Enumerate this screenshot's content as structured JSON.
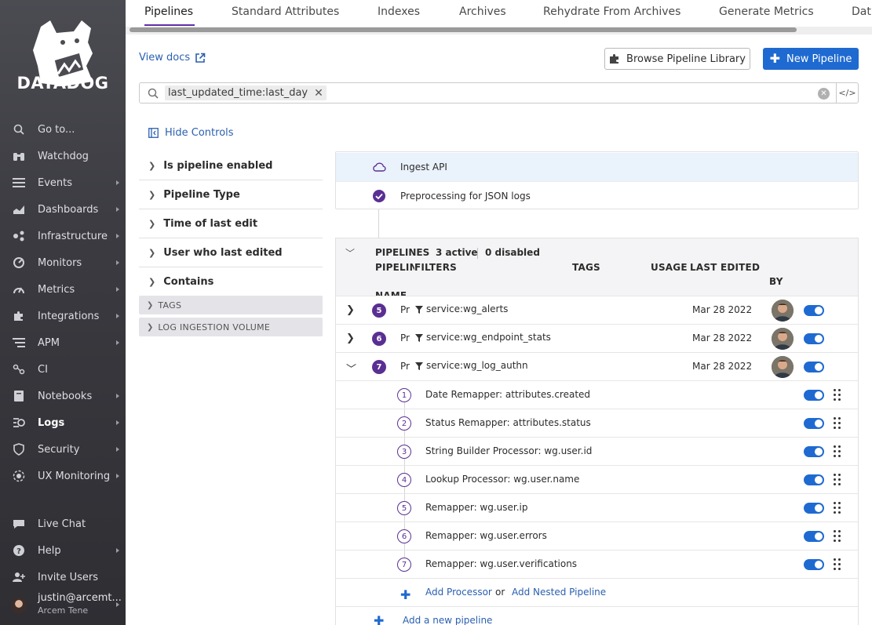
{
  "brand": {
    "name": "DATADOG",
    "accent": "#632ca6",
    "primary_button": "#1f6ad1"
  },
  "sidebar": {
    "items": [
      {
        "label": "Go to...",
        "icon": "search-icon",
        "has_submenu": false
      },
      {
        "label": "Watchdog",
        "icon": "binoculars-icon",
        "has_submenu": false
      },
      {
        "label": "Events",
        "icon": "list-icon",
        "has_submenu": true
      },
      {
        "label": "Dashboards",
        "icon": "chart-icon",
        "has_submenu": true
      },
      {
        "label": "Infrastructure",
        "icon": "hexagon-icon",
        "has_submenu": true
      },
      {
        "label": "Monitors",
        "icon": "monitor-icon",
        "has_submenu": true
      },
      {
        "label": "Metrics",
        "icon": "gauge-icon",
        "has_submenu": true
      },
      {
        "label": "Integrations",
        "icon": "puzzle-icon",
        "has_submenu": true
      },
      {
        "label": "APM",
        "icon": "apm-icon",
        "has_submenu": true
      },
      {
        "label": "CI",
        "icon": "ci-icon",
        "has_submenu": false
      },
      {
        "label": "Notebooks",
        "icon": "notebook-icon",
        "has_submenu": true
      },
      {
        "label": "Logs",
        "icon": "logs-icon",
        "has_submenu": true,
        "active": true
      },
      {
        "label": "Security",
        "icon": "shield-icon",
        "has_submenu": true
      },
      {
        "label": "UX Monitoring",
        "icon": "ux-icon",
        "has_submenu": true
      }
    ],
    "footer": [
      {
        "label": "Live Chat",
        "icon": "chat-icon",
        "has_submenu": false
      },
      {
        "label": "Help",
        "icon": "help-icon",
        "has_submenu": true
      },
      {
        "label": "Invite Users",
        "icon": "invite-icon",
        "has_submenu": false
      }
    ],
    "user": {
      "name": "justin@arcemt...",
      "org": "Arcem Tene"
    }
  },
  "tabs": [
    "Pipelines",
    "Standard Attributes",
    "Indexes",
    "Archives",
    "Rehydrate From Archives",
    "Generate Metrics",
    "Dat"
  ],
  "header": {
    "view_docs": "View docs",
    "browse_label": "Browse Pipeline Library",
    "new_label": "New Pipeline"
  },
  "search": {
    "pill": "last_updated_time:last_day"
  },
  "controls": {
    "hide_label": "Hide Controls",
    "facets": [
      "Is pipeline enabled",
      "Pipeline Type",
      "Time of last edit",
      "User who last edited",
      "Contains"
    ],
    "groups": [
      "TAGS",
      "LOG INGESTION VOLUME"
    ]
  },
  "ingest": {
    "api_label": "Ingest API",
    "preprocessing_label": "Preprocessing for JSON logs"
  },
  "pipelines": {
    "title": "PIPELINES",
    "active": "3 active",
    "disabled": "0 disabled",
    "columns": {
      "name_a": "PIPELINE",
      "name_b": "NAME",
      "filters": "FILTERS",
      "tags": "TAGS",
      "usage": "USAGE",
      "last_edited": "LAST EDITED",
      "by": "BY"
    },
    "rows": [
      {
        "num": "5",
        "name": "Pr",
        "filter": "service:wg_alerts",
        "date": "Mar 28 2022",
        "expanded": false
      },
      {
        "num": "6",
        "name": "Pr",
        "filter": "service:wg_endpoint_stats",
        "date": "Mar 28 2022",
        "expanded": false
      },
      {
        "num": "7",
        "name": "Pr",
        "filter": "service:wg_log_authn",
        "date": "Mar 28 2022",
        "expanded": true
      }
    ],
    "processors": [
      {
        "num": "1",
        "name": "Date Remapper: attributes.created"
      },
      {
        "num": "2",
        "name": "Status Remapper: attributes.status"
      },
      {
        "num": "3",
        "name": "String Builder Processor: wg.user.id"
      },
      {
        "num": "4",
        "name": "Lookup Processor: wg.user.name"
      },
      {
        "num": "5",
        "name": "Remapper: wg.user.ip"
      },
      {
        "num": "6",
        "name": "Remapper: wg.user.errors"
      },
      {
        "num": "7",
        "name": "Remapper: wg.user.verifications"
      }
    ],
    "add_processor": "Add Processor",
    "or": "or",
    "add_nested": "Add Nested Pipeline",
    "add_pipeline": "Add a new pipeline"
  }
}
